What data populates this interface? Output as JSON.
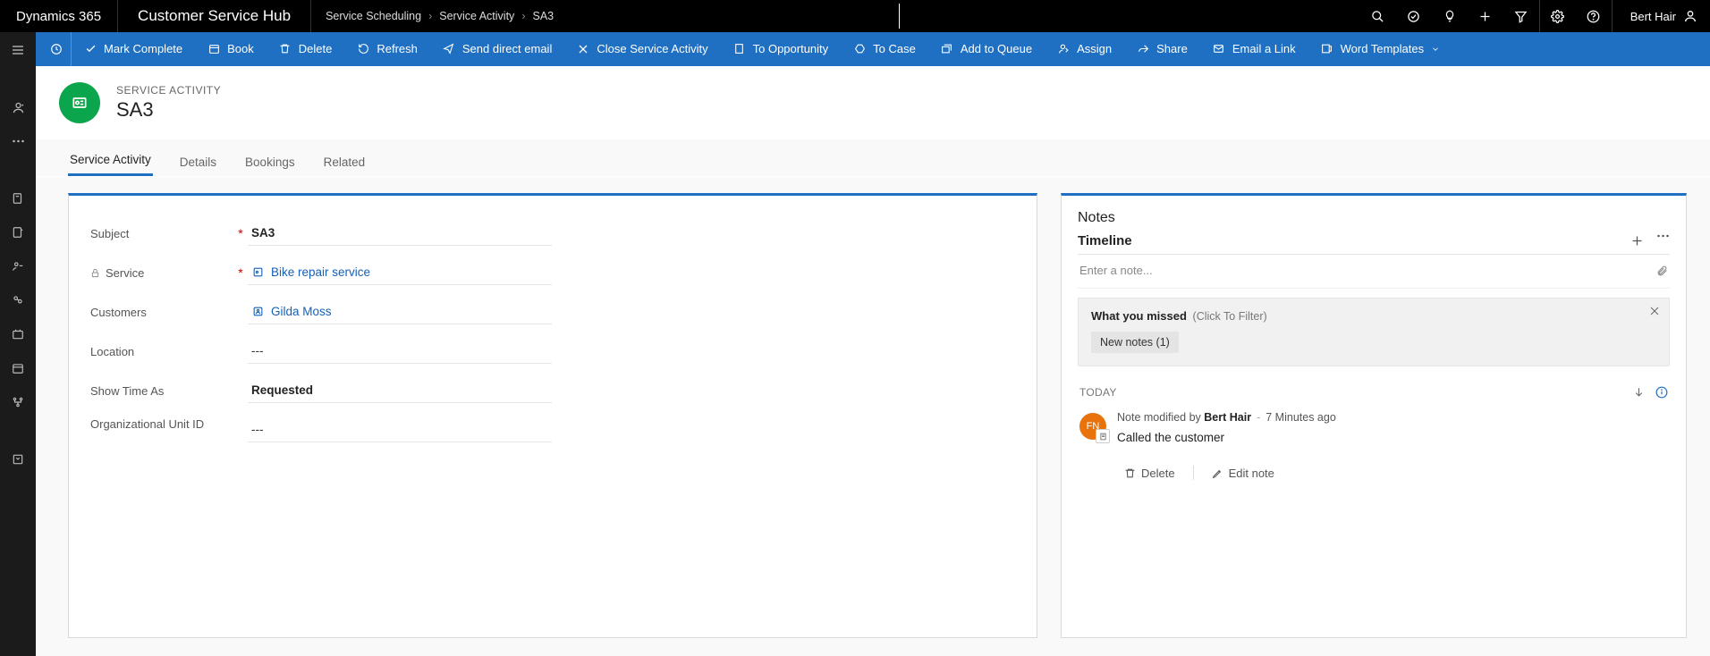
{
  "top": {
    "brand": "Dynamics 365",
    "hub": "Customer Service Hub",
    "crumbs": [
      "Service Scheduling",
      "Service Activity",
      "SA3"
    ],
    "user": "Bert Hair"
  },
  "commands": {
    "mark_complete": "Mark Complete",
    "book": "Book",
    "delete": "Delete",
    "refresh": "Refresh",
    "send_direct_email": "Send direct email",
    "close_activity": "Close Service Activity",
    "to_opportunity": "To Opportunity",
    "to_case": "To Case",
    "add_to_queue": "Add to Queue",
    "assign": "Assign",
    "share": "Share",
    "email_link": "Email a Link",
    "word_templates": "Word Templates"
  },
  "record": {
    "type_label": "SERVICE ACTIVITY",
    "name": "SA3"
  },
  "tabs": {
    "service_activity": "Service Activity",
    "details": "Details",
    "bookings": "Bookings",
    "related": "Related"
  },
  "fields": {
    "subject": {
      "label": "Subject",
      "value": "SA3"
    },
    "service": {
      "label": "Service",
      "value": "Bike repair service"
    },
    "customers": {
      "label": "Customers",
      "value": "Gilda Moss"
    },
    "location": {
      "label": "Location",
      "value": "---"
    },
    "show_time_as": {
      "label": "Show Time As",
      "value": "Requested"
    },
    "org_unit": {
      "label": "Organizational Unit ID",
      "value": "---"
    }
  },
  "notes": {
    "section": "Notes",
    "timeline": "Timeline",
    "placeholder": "Enter a note...",
    "missed_title": "What you missed",
    "missed_hint": "(Click To Filter)",
    "chip": "New notes (1)",
    "today": "TODAY",
    "note1_prefix": "Note modified by ",
    "note1_user": "Bert Hair",
    "note1_time": "7 Minutes ago",
    "note1_body": "Called the customer",
    "delete": "Delete",
    "edit": "Edit note",
    "avatar_initials": "FN"
  }
}
